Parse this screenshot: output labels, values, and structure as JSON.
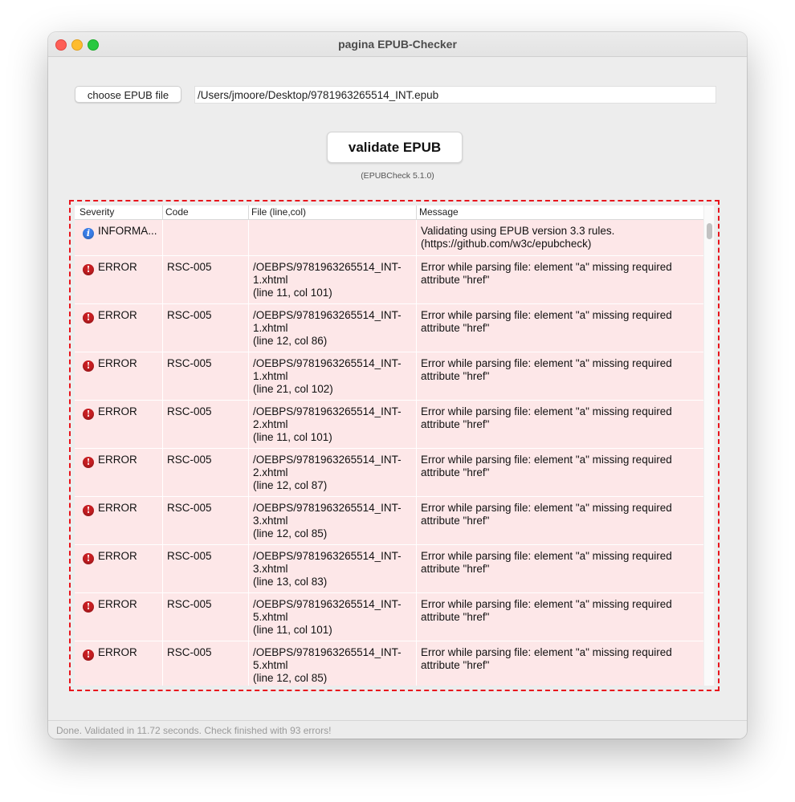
{
  "window": {
    "title": "pagina EPUB-Checker"
  },
  "toolbar": {
    "choose_label": "choose EPUB file",
    "file_path": "/Users/jmoore/Desktop/9781963265514_INT.epub",
    "validate_label": "validate EPUB",
    "version_text": "(EPUBCheck 5.1.0)"
  },
  "table": {
    "columns": [
      "Severity",
      "Code",
      "File (line,col)",
      "Message"
    ],
    "rows": [
      {
        "severity": "INFORMA...",
        "type": "info",
        "code": "",
        "file": [],
        "message": [
          "Validating using EPUB version 3.3 rules.",
          "(https://github.com/w3c/epubcheck)"
        ]
      },
      {
        "severity": "ERROR",
        "type": "error",
        "code": "RSC-005",
        "file": [
          "/OEBPS/9781963265514_INT-",
          "1.xhtml",
          "(line 11, col 101)"
        ],
        "message": [
          "Error while parsing file: element \"a\" missing required",
          "attribute \"href\""
        ]
      },
      {
        "severity": "ERROR",
        "type": "error",
        "code": "RSC-005",
        "file": [
          "/OEBPS/9781963265514_INT-",
          "1.xhtml",
          "(line 12, col 86)"
        ],
        "message": [
          "Error while parsing file: element \"a\" missing required",
          "attribute \"href\""
        ]
      },
      {
        "severity": "ERROR",
        "type": "error",
        "code": "RSC-005",
        "file": [
          "/OEBPS/9781963265514_INT-",
          "1.xhtml",
          "(line 21, col 102)"
        ],
        "message": [
          "Error while parsing file: element \"a\" missing required",
          "attribute \"href\""
        ]
      },
      {
        "severity": "ERROR",
        "type": "error",
        "code": "RSC-005",
        "file": [
          "/OEBPS/9781963265514_INT-",
          "2.xhtml",
          "(line 11, col 101)"
        ],
        "message": [
          "Error while parsing file: element \"a\" missing required",
          "attribute \"href\""
        ]
      },
      {
        "severity": "ERROR",
        "type": "error",
        "code": "RSC-005",
        "file": [
          "/OEBPS/9781963265514_INT-",
          "2.xhtml",
          "(line 12, col 87)"
        ],
        "message": [
          "Error while parsing file: element \"a\" missing required",
          "attribute \"href\""
        ]
      },
      {
        "severity": "ERROR",
        "type": "error",
        "code": "RSC-005",
        "file": [
          "/OEBPS/9781963265514_INT-",
          "3.xhtml",
          "(line 12, col 85)"
        ],
        "message": [
          "Error while parsing file: element \"a\" missing required",
          "attribute \"href\""
        ]
      },
      {
        "severity": "ERROR",
        "type": "error",
        "code": "RSC-005",
        "file": [
          "/OEBPS/9781963265514_INT-",
          "3.xhtml",
          "(line 13, col 83)"
        ],
        "message": [
          "Error while parsing file: element \"a\" missing required",
          "attribute \"href\""
        ]
      },
      {
        "severity": "ERROR",
        "type": "error",
        "code": "RSC-005",
        "file": [
          "/OEBPS/9781963265514_INT-",
          "5.xhtml",
          "(line 11, col 101)"
        ],
        "message": [
          "Error while parsing file: element \"a\" missing required",
          "attribute \"href\""
        ]
      },
      {
        "severity": "ERROR",
        "type": "error",
        "code": "RSC-005",
        "file": [
          "/OEBPS/9781963265514_INT-",
          "5.xhtml",
          "(line 12, col 85)"
        ],
        "message": [
          "Error while parsing file: element \"a\" missing required",
          "attribute \"href\""
        ]
      }
    ]
  },
  "status": {
    "text": "Done. Validated in 11.72 seconds. Check finished with 93 errors!"
  },
  "colors": {
    "row_error_bg": "#fde7e8",
    "error_icon": "#c81e22",
    "info_icon": "#3a7ee8",
    "highlight_border": "#e8141c"
  },
  "icons": {
    "error": "exclamation-circle-icon",
    "info": "info-circle-icon"
  }
}
